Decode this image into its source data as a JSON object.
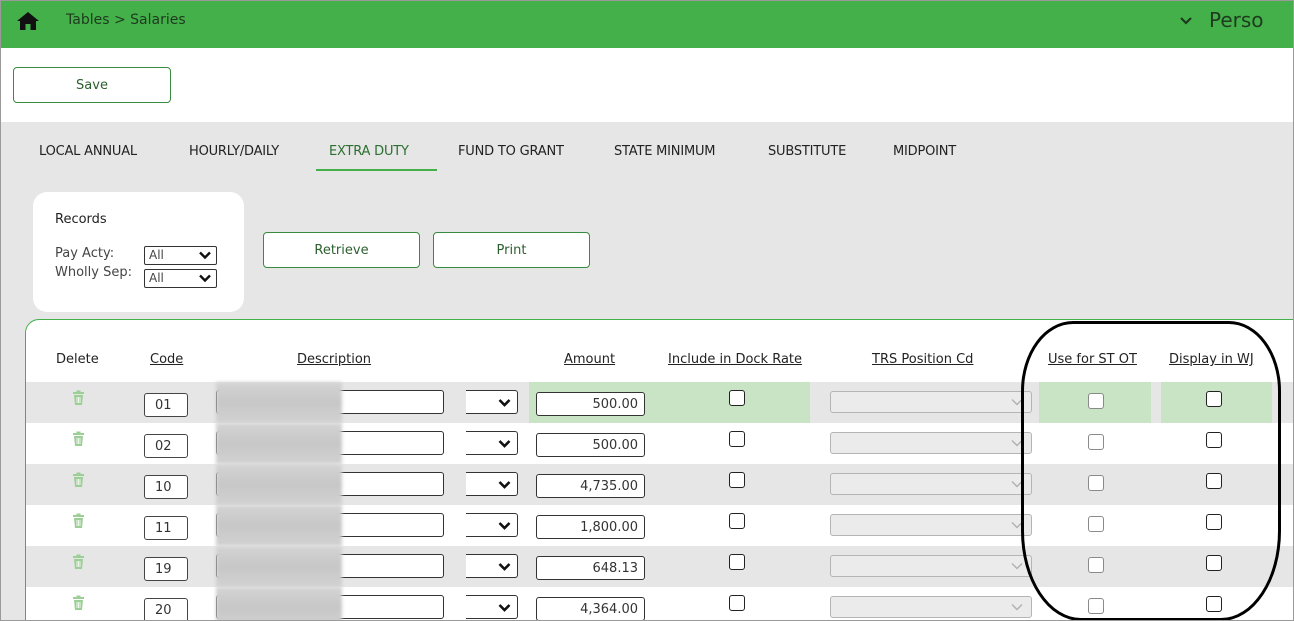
{
  "breadcrumb": "Tables > Salaries",
  "user_menu": {
    "label": "Perso"
  },
  "toolbar": {
    "save_label": "Save"
  },
  "tabs": [
    {
      "label": "LOCAL ANNUAL",
      "active": false
    },
    {
      "label": "HOURLY/DAILY",
      "active": false
    },
    {
      "label": "EXTRA DUTY",
      "active": true
    },
    {
      "label": "FUND TO GRANT",
      "active": false
    },
    {
      "label": "STATE MINIMUM",
      "active": false
    },
    {
      "label": "SUBSTITUTE",
      "active": false
    },
    {
      "label": "MIDPOINT",
      "active": false
    }
  ],
  "records": {
    "title": "Records",
    "pay_acty_label": "Pay Acty:",
    "pay_acty_value": "All",
    "wholly_sep_label": "Wholly Sep:",
    "wholly_sep_value": "All"
  },
  "actions": {
    "retrieve_label": "Retrieve",
    "print_label": "Print"
  },
  "columns": {
    "delete": "Delete",
    "code": "Code",
    "description": "Description",
    "amount": "Amount",
    "dock_rate": "Include in Dock Rate",
    "trs_position": "TRS Position Cd",
    "st_ot": "Use for ST OT",
    "display_wj": "Display in WJ"
  },
  "rows": [
    {
      "code": "01",
      "amount": "500.00",
      "selected": true
    },
    {
      "code": "02",
      "amount": "500.00"
    },
    {
      "code": "10",
      "amount": "4,735.00"
    },
    {
      "code": "11",
      "amount": "1,800.00"
    },
    {
      "code": "19",
      "amount": "648.13"
    },
    {
      "code": "20",
      "amount": "4,364.00"
    }
  ],
  "colors": {
    "brand": "#43b04a",
    "highlight": "#c9e4c5"
  }
}
